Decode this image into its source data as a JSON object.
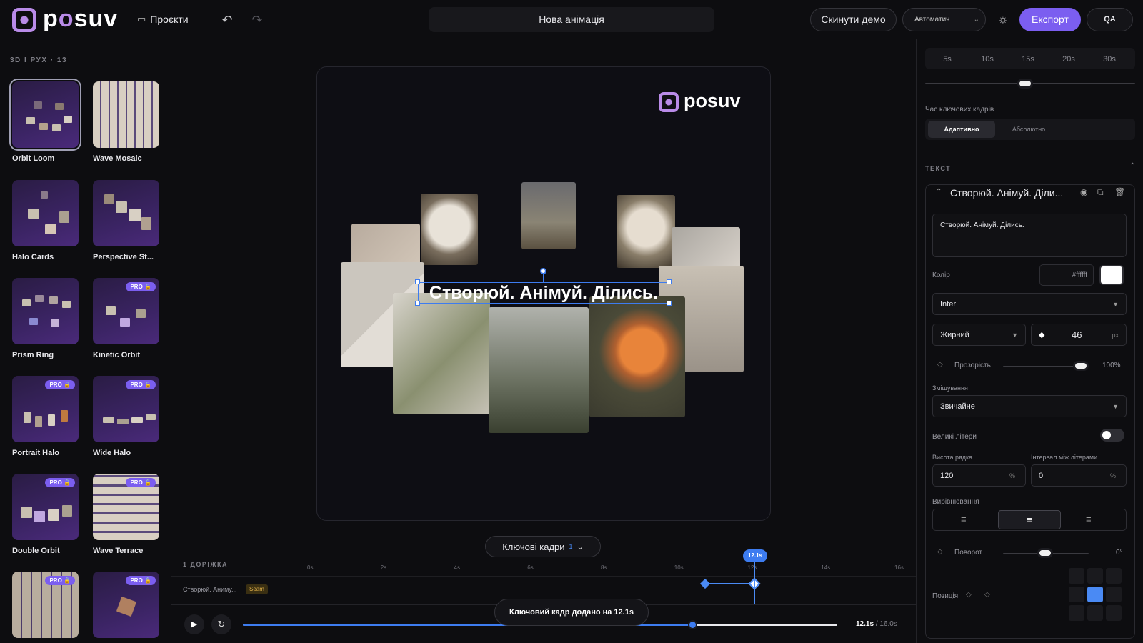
{
  "app": {
    "brand": "posuv",
    "accent": "#7b5ef0"
  },
  "toolbar": {
    "projects_label": "Проєкти",
    "animation_title": "Нова анімація",
    "reset_demo_label": "Скинути демо",
    "mode_select_value": "Автоматич",
    "export_label": "Експорт",
    "qa_label": "QA"
  },
  "templates": {
    "section_label": "3D І РУХ · 13",
    "items": [
      {
        "name": "Orbit Loom",
        "pro": false
      },
      {
        "name": "Wave Mosaic",
        "pro": false
      },
      {
        "name": "Halo Cards",
        "pro": false
      },
      {
        "name": "Perspective St...",
        "pro": false
      },
      {
        "name": "Prism Ring",
        "pro": false
      },
      {
        "name": "Kinetic Orbit",
        "pro": true
      },
      {
        "name": "Portrait Halo",
        "pro": true
      },
      {
        "name": "Wide Halo",
        "pro": true
      },
      {
        "name": "Double Orbit",
        "pro": true
      },
      {
        "name": "Wave Terrace",
        "pro": true
      },
      {
        "name": "",
        "pro": true
      },
      {
        "name": "",
        "pro": true
      }
    ],
    "pro_label": "PRO 🔒"
  },
  "canvas": {
    "brand_label": "posuv",
    "headline": "Створюй. Анімуй. Ділись."
  },
  "right_panel": {
    "durations": [
      "5s",
      "10s",
      "15s",
      "20s",
      "30s"
    ],
    "keyframe_timing_label": "Час ключових кадрів",
    "timing_options": [
      "Адаптивно",
      "Абсолютно"
    ],
    "text_section_label": "ТЕКСТ",
    "layer_title": "Створюй. Анімуй. Діли...",
    "text_value": "Створюй. Анімуй. Ділись.",
    "color_label": "Колір",
    "color_hex": "#ffffff",
    "font_value": "Inter",
    "weight_value": "Жирний",
    "size_value": "46",
    "size_unit": "px",
    "opacity_label": "Прозорість",
    "opacity_value": "100%",
    "opacity_fraction": 1.0,
    "blend_label": "Змішування",
    "blend_value": "Звичайне",
    "uppercase_label": "Великі літери",
    "line_height_label": "Висота рядка",
    "line_height_value": "120",
    "letter_spacing_label": "Інтервал між літерами",
    "letter_spacing_value": "0",
    "percent_unit": "%",
    "align_label": "Вирівнювання",
    "rotation_label": "Поворот",
    "rotation_value": "0°",
    "position_label": "Позиція"
  },
  "timeline": {
    "keyframes_button": "Ключові кадри",
    "keyframes_count": "1",
    "tracks_label": "1 ДОРІЖКА",
    "track_name": "Створюй. Аниму...",
    "track_tag": "Seam",
    "playhead_label": "12.1s",
    "ticks": [
      "0s",
      "2s",
      "4s",
      "6s",
      "8s",
      "10s",
      "12s",
      "14s",
      "16s"
    ],
    "toast": "Ключовий кадр додано на 12.1s",
    "current_time": "12.1s",
    "total_time": "/ 16.0s",
    "progress_fraction": 0.756
  }
}
